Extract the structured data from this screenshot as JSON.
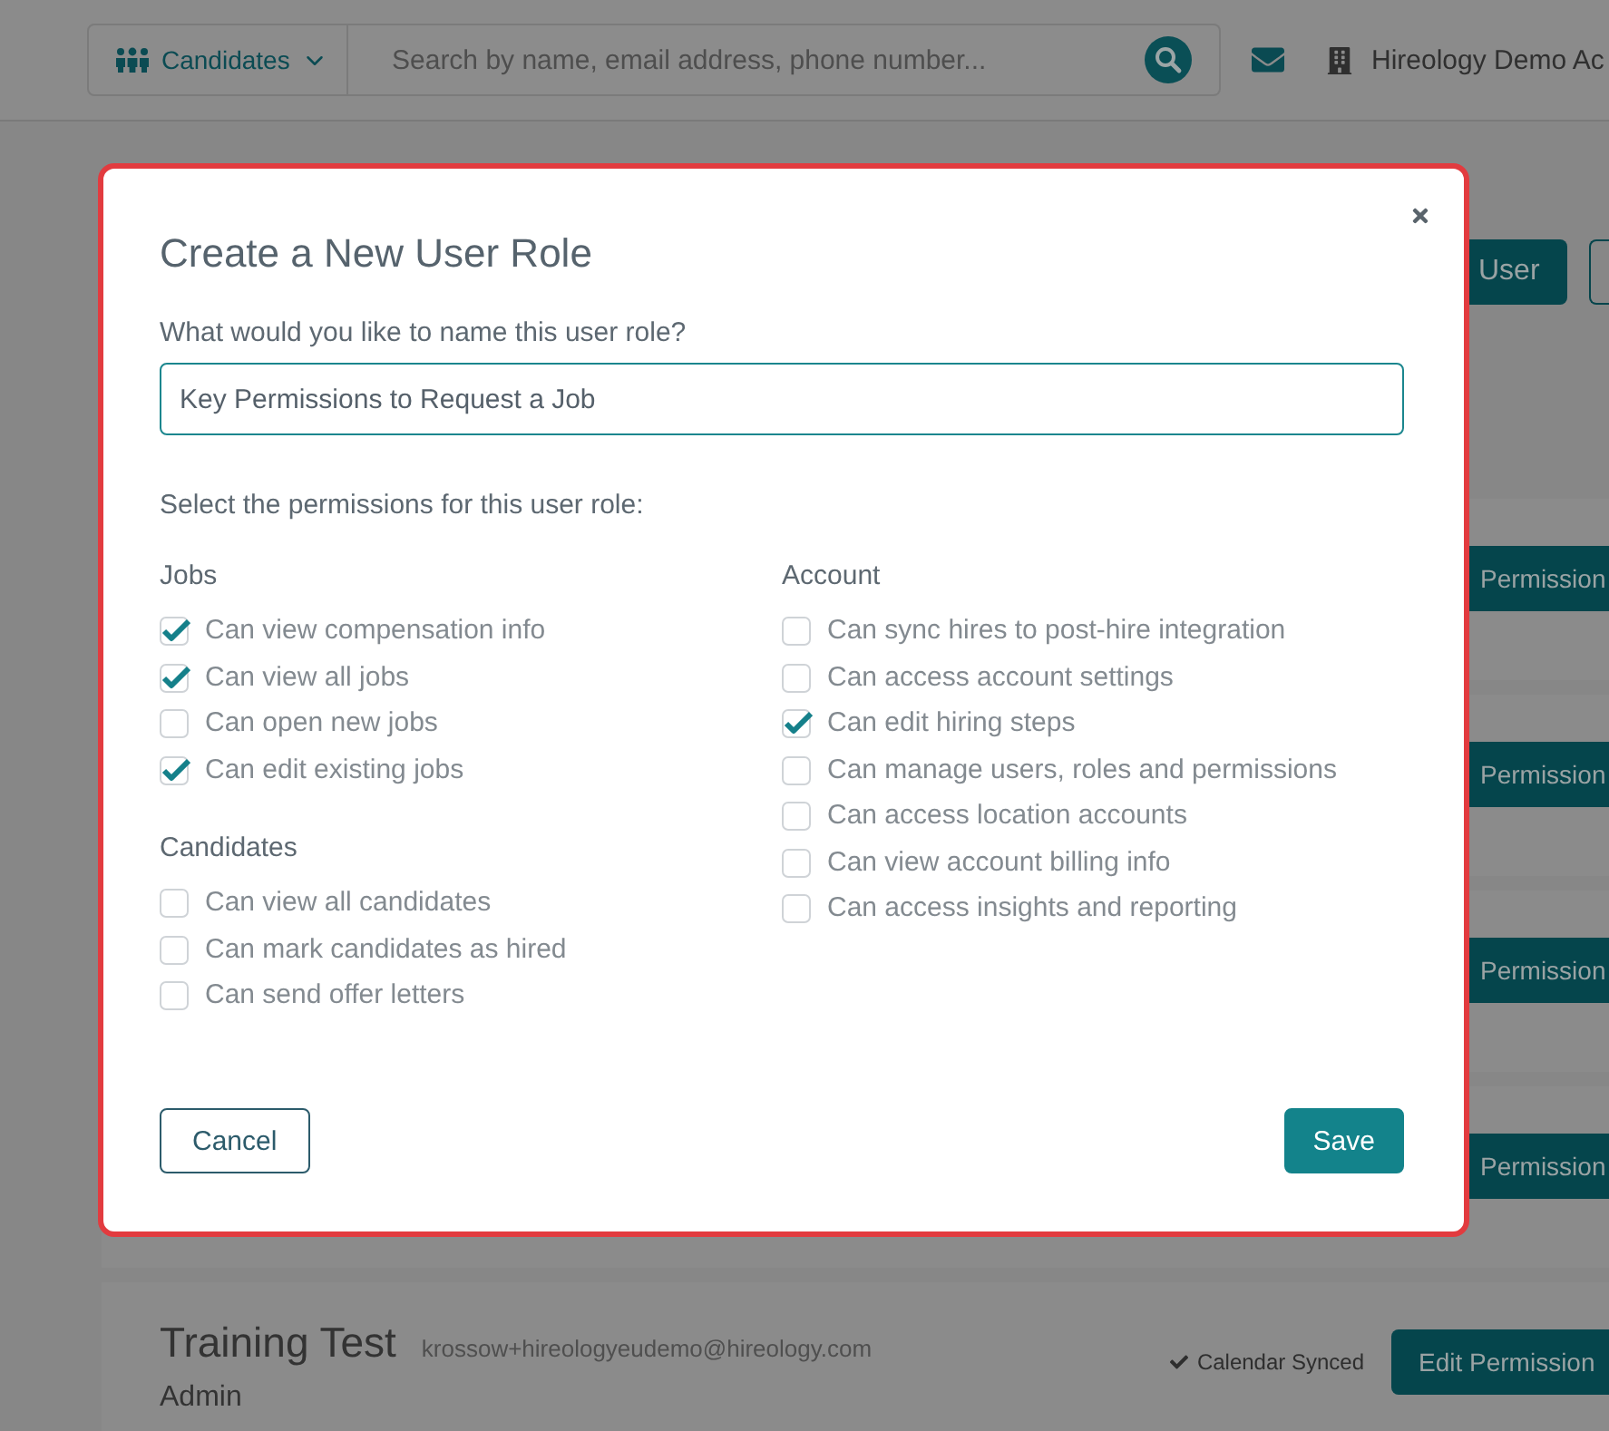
{
  "header": {
    "scope_menu": "Candidates",
    "search": {
      "placeholder": "Search by name, email address, phone number..."
    },
    "account": "Hireology Demo Ac"
  },
  "toolbar": [
    {
      "kind": "primary",
      "label": "User"
    },
    {
      "kind": "outline"
    }
  ],
  "rows": [
    {
      "kind": "covered",
      "button": "Permission"
    },
    {
      "kind": "covered",
      "button": "Permission"
    },
    {
      "kind": "covered",
      "button": "Permission"
    },
    {
      "kind": "covered",
      "button": "Permission"
    },
    {
      "kind": "user",
      "name": "Training Test",
      "email": "krossow+hireologyeudemo@hireology.com",
      "role": "Admin",
      "status": "Calendar Synced",
      "button": "Edit Permission"
    }
  ],
  "dialog": {
    "title": "Create a New User Role",
    "name_label": "What would you like to name this user role?",
    "name_value": "Key Permissions to Request a Job",
    "permissions_label": "Select the permissions for this user role:",
    "columns": [
      {
        "groups": [
          {
            "heading": "Jobs",
            "items": [
              {
                "label": "Can view compensation info",
                "checked": true
              },
              {
                "label": "Can view all jobs",
                "checked": true
              },
              {
                "label": "Can open new jobs",
                "checked": false
              },
              {
                "label": "Can edit existing jobs",
                "checked": true
              }
            ]
          },
          {
            "heading": "Candidates",
            "items": [
              {
                "label": "Can view all candidates",
                "checked": false
              },
              {
                "label": "Can mark candidates as hired",
                "checked": false
              },
              {
                "label": "Can send offer letters",
                "checked": false
              }
            ]
          }
        ]
      },
      {
        "groups": [
          {
            "heading": "Account",
            "items": [
              {
                "label": "Can sync hires to post-hire integration",
                "checked": false
              },
              {
                "label": "Can access account settings",
                "checked": false
              },
              {
                "label": "Can edit hiring steps",
                "checked": true
              },
              {
                "label": "Can manage users, roles and permissions",
                "checked": false
              },
              {
                "label": "Can access location accounts",
                "checked": false
              },
              {
                "label": "Can view account billing info",
                "checked": false
              },
              {
                "label": "Can access insights and reporting",
                "checked": false
              }
            ]
          }
        ]
      }
    ],
    "buttons": [
      {
        "kind": "secondary",
        "label": "Cancel"
      },
      {
        "kind": "primary",
        "label": "Save"
      }
    ]
  }
}
